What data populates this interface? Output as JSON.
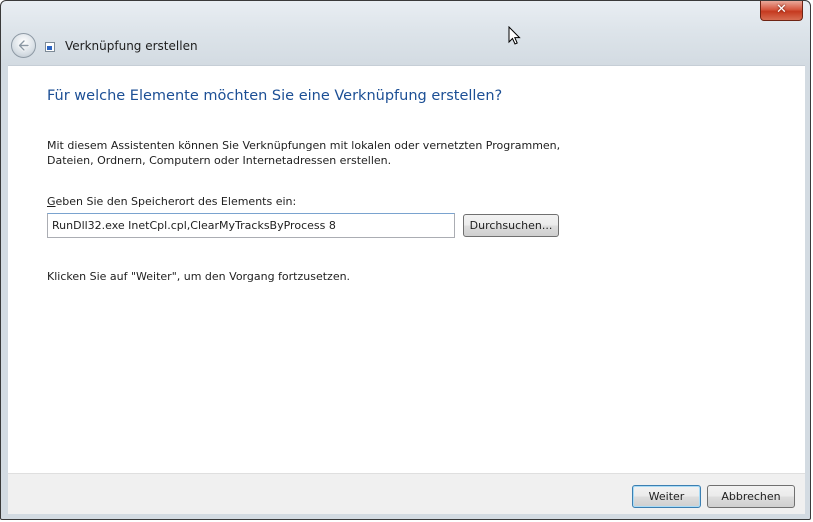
{
  "window": {
    "title": "Verknüpfung erstellen",
    "close_glyph": "✕"
  },
  "content": {
    "heading": "Für welche Elemente möchten Sie eine Verknüpfung erstellen?",
    "description": "Mit diesem Assistenten können Sie Verknüpfungen mit lokalen oder vernetzten Programmen, Dateien, Ordnern, Computern oder Internetadressen erstellen.",
    "location_label_accel": "G",
    "location_label_rest": "eben Sie den Speicherort des Elements ein:",
    "location_value": "RunDll32.exe InetCpl.cpl,ClearMyTracksByProcess 8",
    "browse_label": "Durchsuchen...",
    "hint": "Klicken Sie auf \"Weiter\", um den Vorgang fortzusetzen."
  },
  "footer": {
    "next_label": "Weiter",
    "cancel_label": "Abbrechen"
  },
  "icons": {
    "back": "back-arrow-icon",
    "title": "shortcut-icon",
    "close": "close-icon",
    "cursor": "mouse-cursor-icon"
  }
}
